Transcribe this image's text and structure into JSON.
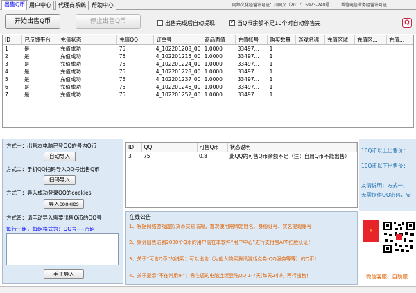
{
  "tabs": [
    {
      "label": "出售Q币",
      "active": true
    },
    {
      "label": "用户中心",
      "active": false
    },
    {
      "label": "代理商系统",
      "active": false
    },
    {
      "label": "帮助中心",
      "active": false
    }
  ],
  "header": {
    "license_left": "网络文化经营许可证：川网文（2017）5973-240号",
    "license_right": "增值电信业务经营许可证"
  },
  "toolbar": {
    "start_label": "开始出售Q币",
    "stop_label": "停止出售Q币",
    "auto_withdraw_label": "出售完成后自动提现",
    "auto_withdraw_checked": false,
    "auto_stop_label": "当Q币余额不足10个时自动停售完",
    "auto_stop_checked": true,
    "help_icon": "qq-help-icon"
  },
  "orders_table": {
    "columns": [
      "ID",
      "已反馈平台",
      "充值状态",
      "充值QQ",
      "订单号",
      "商品面值",
      "充值帐号",
      "购买数量",
      "游戏名称",
      "充值区域",
      "充值区...",
      "充值..."
    ],
    "rows": [
      [
        "1",
        "是",
        "充值成功",
        "75",
        "4_102201208_00",
        "1.0000",
        "33497...",
        "1",
        "",
        "",
        "",
        ""
      ],
      [
        "2",
        "是",
        "充值成功",
        "75",
        "4_102201215_00",
        "1.0000",
        "33497...",
        "1",
        "",
        "",
        "",
        ""
      ],
      [
        "3",
        "是",
        "充值成功",
        "75",
        "4_102201224_00",
        "1.0000",
        "33497...",
        "1",
        "",
        "",
        "",
        ""
      ],
      [
        "4",
        "是",
        "充值成功",
        "75",
        "4_102201228_00",
        "1.0000",
        "33497...",
        "1",
        "",
        "",
        "",
        ""
      ],
      [
        "5",
        "是",
        "充值成功",
        "75",
        "4_102201237_00",
        "1.0000",
        "33497...",
        "1",
        "",
        "",
        "",
        ""
      ],
      [
        "6",
        "是",
        "充值成功",
        "75",
        "4_102201246_00",
        "1.0000",
        "33497...",
        "1",
        "",
        "",
        "",
        ""
      ],
      [
        "7",
        "是",
        "充值成功",
        "75",
        "4_102201252_00",
        "1.0000",
        "33497...",
        "1",
        "",
        "",
        "",
        ""
      ]
    ]
  },
  "methods": {
    "method1_label": "方式一：出售本电脑已登QQ的号内Q币",
    "method1_button": "自动导入",
    "method2_label": "方式二：手机QQ扫码导入QQ号出售Q币",
    "method2_button": "扫码导入",
    "method3_label": "方式三：导入成功登录QQ的cookies",
    "method3_button": "导入cookies",
    "method4_label": "方式四：请手动导入需要出售Q币的QQ号",
    "format_hint": "每行一组，每组格式为：QQ号----密码",
    "import_textarea_value": "",
    "manual_import_button": "手工导入"
  },
  "qq_table": {
    "columns": [
      "ID",
      "QQ",
      "可售Q币",
      "状态说明"
    ],
    "rows": [
      [
        "3",
        "75",
        "0.8",
        "此QQ的可售Q币余额不足（注：自用Q币不能出售）"
      ]
    ]
  },
  "notice": {
    "title": "在线公告",
    "lines": [
      "1、根据网络游戏虚拟货币交易法规，首次使用需绑定姓名、身份证号、实名提现账号",
      "2、累计出售达到2000个Q币的用户需在本软件“用户中心”进行支付宝APP扫脸认证！",
      "3、关于“可售Q币”的说明：可以出售（为他人购买腾讯游戏点券-QQ服务等等）的Q币！",
      "4、关于提示“不在常用IP”：需在您的电脑连续登陆QQ 1-7天(每天2小时)再行出售！"
    ]
  },
  "right_panel": {
    "line1": "10Q币以上出售价：",
    "line2": "10Q币以下出售价：",
    "line3": "友情说明：方式一、",
    "line4": "无需提供QQ密码，安",
    "contact": "微信客服、自助服"
  },
  "colors": {
    "panel_bg": "#dde9f4",
    "notice_text": "#e06000",
    "link_blue": "#0000ff"
  }
}
